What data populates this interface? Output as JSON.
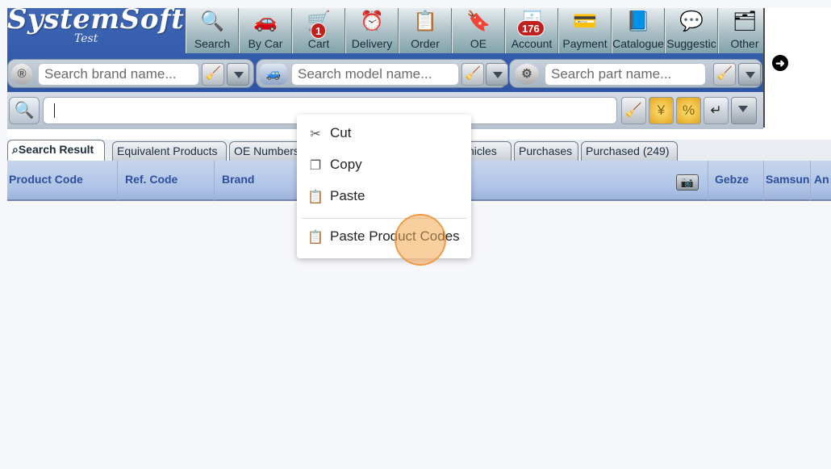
{
  "app": {
    "logo_text": "SystemSoft",
    "logo_subtitle": "Test"
  },
  "toolbar": [
    {
      "label": "Search",
      "icon": "search-icon"
    },
    {
      "label": "By Car",
      "icon": "car-icon"
    },
    {
      "label": "Cart",
      "icon": "cart-icon",
      "badge": "1"
    },
    {
      "label": "Delivery",
      "icon": "delivery-icon"
    },
    {
      "label": "Order",
      "icon": "order-icon"
    },
    {
      "label": "OE",
      "icon": "oe-icon"
    },
    {
      "label": "Account",
      "icon": "account-icon",
      "badge": "176"
    },
    {
      "label": "Payment",
      "icon": "payment-icon"
    },
    {
      "label": "Catalogue",
      "icon": "catalogue-icon"
    },
    {
      "label": "Suggestic",
      "icon": "suggestion-icon"
    },
    {
      "label": "Other",
      "icon": "other-icon"
    }
  ],
  "search": {
    "brand_placeholder": "Search brand name...",
    "model_placeholder": "Search model name...",
    "part_placeholder": "Search part name...",
    "main_value": ""
  },
  "tabs": [
    {
      "label": "Search Result",
      "active": true
    },
    {
      "label": "Equivalent Products",
      "active": false
    },
    {
      "label": "OE Numbers",
      "active": false
    },
    {
      "label": "hicles",
      "active": false
    },
    {
      "label": "Purchases",
      "active": false
    },
    {
      "label": "Purchased (249)",
      "active": false
    }
  ],
  "columns": {
    "product_code": "Product Code",
    "ref_code": "Ref. Code",
    "brand": "Brand",
    "gebze": "Gebze",
    "samsun": "Samsun",
    "an": "An"
  },
  "context_menu": {
    "cut": "Cut",
    "copy": "Copy",
    "paste": "Paste",
    "paste_product_codes": "Paste Product Codes"
  },
  "colors": {
    "header_blue": "#3f67b6",
    "column_header": "#aec3e6",
    "badge_red": "#c0201e",
    "click_marker": "#f6a852"
  }
}
